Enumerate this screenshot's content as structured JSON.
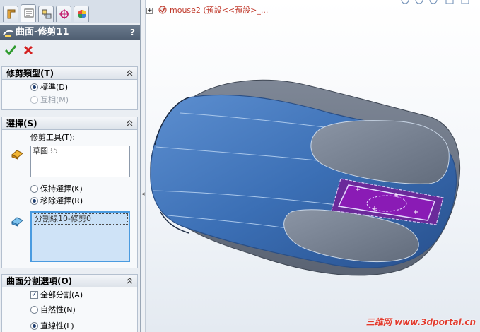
{
  "panel": {
    "title": "曲面-修剪11",
    "help": "?",
    "groups": {
      "trim_type": {
        "header": "修剪類型(T)",
        "options": [
          {
            "label": "標準(D)",
            "state": "selected"
          },
          {
            "label": "互相(M)",
            "state": "disabled"
          }
        ]
      },
      "selections": {
        "header": "選擇(S)",
        "tool_label": "修剪工具(T):",
        "tool_items": [
          "草圖35"
        ],
        "keep_remove": [
          {
            "label": "保持選擇(K)",
            "state": "unselected"
          },
          {
            "label": "移除選擇(R)",
            "state": "selected"
          }
        ],
        "pieces_items": [
          "分割線10-修剪0"
        ]
      },
      "split_options": {
        "header": "曲面分割選項(O)",
        "split_all": {
          "label": "全部分割(A)",
          "checked": true
        },
        "options": [
          {
            "label": "自然性(N)",
            "state": "unselected"
          },
          {
            "label": "直線性(L)",
            "state": "selected"
          }
        ]
      }
    }
  },
  "tree": {
    "expander": "+",
    "model_name": "mouse2",
    "config": "(預設<<預設>_..."
  },
  "watermark": "三维网 www.3dportal.cn",
  "icons": {
    "tabs": [
      "feature-manager-icon",
      "property-manager-icon",
      "configuration-manager-icon",
      "dimxpert-icon",
      "display-manager-icon"
    ],
    "feature": "surface-trim-icon",
    "ok": "checkmark-icon",
    "cancel": "close-icon",
    "tool_bucket": "selection-bucket-icon",
    "pieces_bucket": "selection-bucket-icon",
    "part": "part-icon"
  },
  "colors": {
    "accent_blue": "#4a9be0",
    "model_blue": "#3b6fb5",
    "trim_purple": "#8a1bb5",
    "ok_green": "#2e9b2e",
    "cancel_red": "#d42020"
  }
}
